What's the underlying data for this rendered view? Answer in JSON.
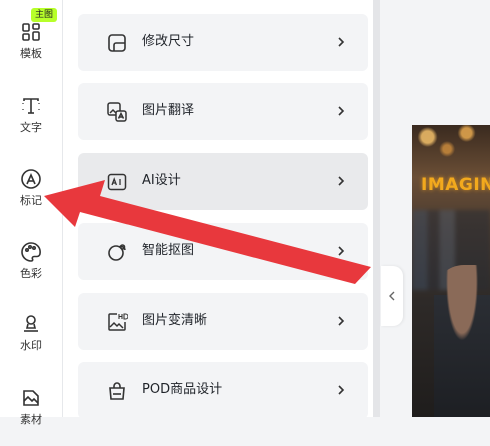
{
  "sidebar": {
    "badge": "主图",
    "items": [
      {
        "label": "模板",
        "icon": "template-grid-icon"
      },
      {
        "label": "文字",
        "icon": "text-icon"
      },
      {
        "label": "标记",
        "icon": "mark-icon"
      },
      {
        "label": "色彩",
        "icon": "palette-icon"
      },
      {
        "label": "水印",
        "icon": "watermark-stamp-icon"
      },
      {
        "label": "素材",
        "icon": "material-icon"
      }
    ]
  },
  "menu": {
    "items": [
      {
        "label": "修改尺寸",
        "icon": "resize-icon"
      },
      {
        "label": "图片翻译",
        "icon": "image-translate-icon"
      },
      {
        "label": "AI设计",
        "icon": "ai-icon",
        "active": true
      },
      {
        "label": "智能抠图",
        "icon": "cutout-icon"
      },
      {
        "label": "图片变清晰",
        "icon": "hd-image-icon"
      },
      {
        "label": "POD商品设计",
        "icon": "shopping-bag-icon"
      }
    ]
  },
  "canvas": {
    "photo_sign_text": "IMAGIN"
  },
  "colors": {
    "arrow": "#e8383d",
    "badge": "#b7ff2a"
  }
}
